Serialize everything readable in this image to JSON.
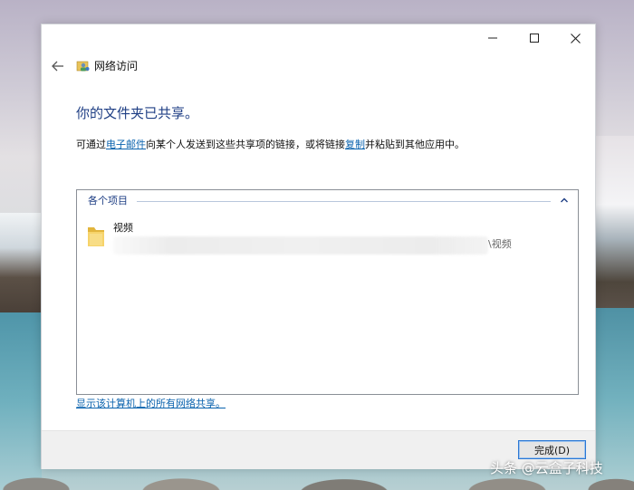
{
  "window": {
    "app_title": "网络访问",
    "controls": {
      "minimize": "minimize-icon",
      "maximize": "maximize-icon",
      "close": "close-icon"
    }
  },
  "nav": {
    "back": "back-arrow-icon"
  },
  "main": {
    "heading": "你的文件夹已共享。",
    "description": {
      "part1": "可通过",
      "email_link": "电子邮件",
      "part2": "向某个人发送到这些共享项的链接，或将链接",
      "copy_link": "复制",
      "part3": "并粘贴到其他应用中。"
    },
    "list": {
      "group_header": "各个项目",
      "items": [
        {
          "name": "视频",
          "path_suffix": "\\视频",
          "icon": "folder-icon"
        }
      ]
    },
    "show_all_shares": "显示该计算机上的所有网络共享。"
  },
  "footer": {
    "finish_button": "完成(D)"
  },
  "watermark": "头条 @云盒子科技",
  "colors": {
    "heading": "#1e3e84",
    "link": "#0b63ae",
    "button_border": "#2b78d4"
  }
}
